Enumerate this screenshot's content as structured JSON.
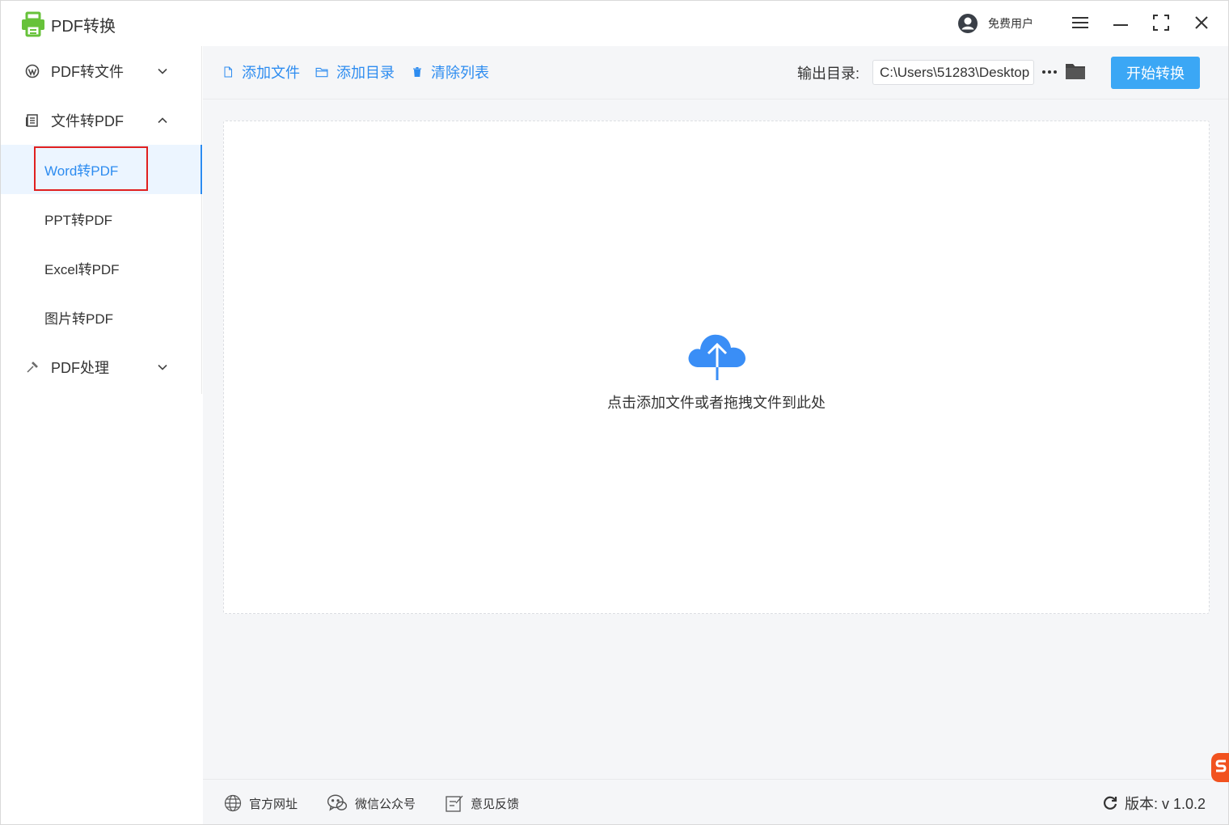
{
  "app": {
    "title": "PDF转换",
    "accent": "#2d8cf0",
    "brand_green": "#67c23a"
  },
  "titlebar": {
    "user_label": "免费用户"
  },
  "sidebar": {
    "group1": {
      "label": "PDF转文件",
      "icon": "wordpress-icon"
    },
    "group2": {
      "label": "文件转PDF",
      "icon": "document-icon",
      "items": [
        "Word转PDF",
        "PPT转PDF",
        "Excel转PDF",
        "图片转PDF"
      ]
    },
    "group3": {
      "label": "PDF处理",
      "icon": "wrench-icon"
    },
    "active_item": "Word转PDF"
  },
  "toolbar": {
    "add_file": "添加文件",
    "add_folder": "添加目录",
    "clear_list": "清除列表",
    "output_label": "输出目录:",
    "output_path": "C:\\Users\\51283\\Desktop",
    "start": "开始转换"
  },
  "dropzone": {
    "text": "点击添加文件或者拖拽文件到此处"
  },
  "footer": {
    "website": "官方网址",
    "wechat": "微信公众号",
    "feedback": "意见反馈",
    "version": "版本: v 1.0.2"
  }
}
